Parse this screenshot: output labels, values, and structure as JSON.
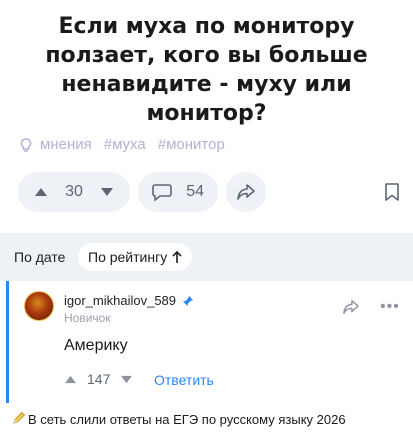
{
  "question": {
    "title": "Если муха по монитору ползает, кого вы больше ненавидите - муху или монитор?"
  },
  "tags": {
    "first": "мнения",
    "items": [
      "#муха",
      "#монитор"
    ]
  },
  "stats": {
    "votes": "30",
    "comments": "54"
  },
  "sort": {
    "by_date": "По дате",
    "by_rating": "По рейтингу"
  },
  "comment": {
    "username": "igor_mikhailov_589",
    "rank": "Новичок",
    "text": "Америку",
    "votes": "147",
    "reply_label": "Ответить",
    "more": "•••"
  },
  "promo": {
    "text": "В сеть слили ответы на ЕГЭ по русскому языку 2026"
  },
  "colors": {
    "accent": "#2b86f5",
    "tag": "#b7b0d6",
    "pill_bg": "#eef2f7"
  }
}
